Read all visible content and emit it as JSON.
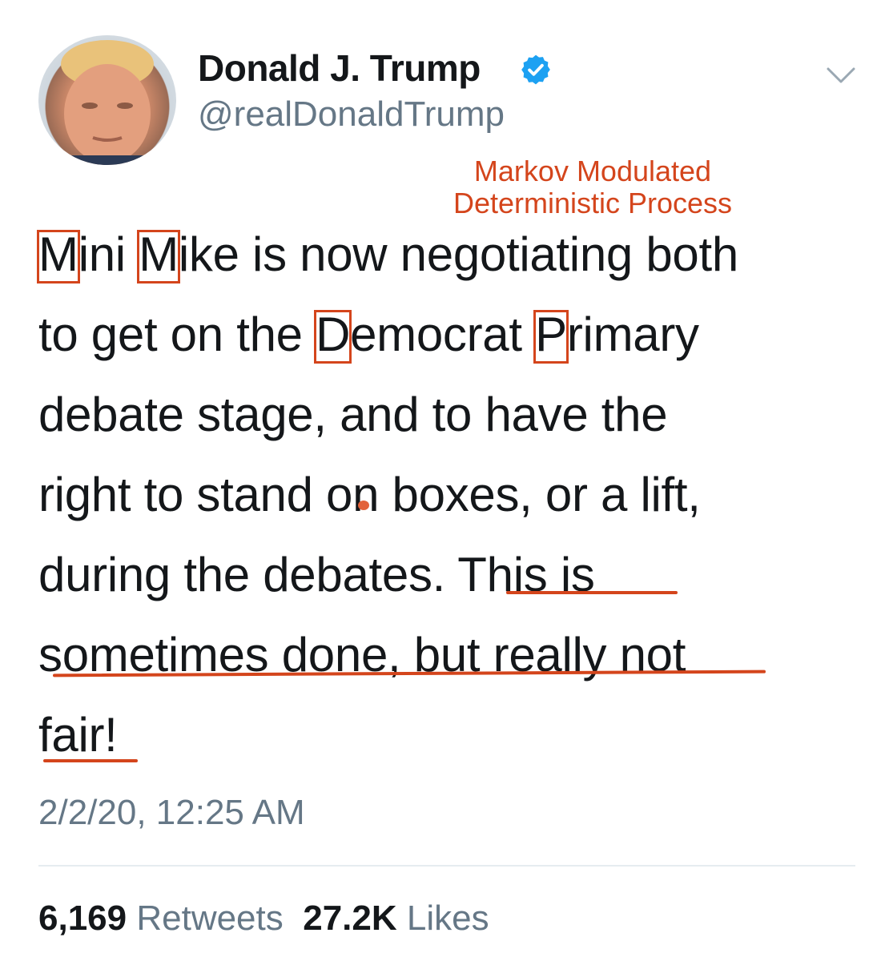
{
  "author": {
    "display_name": "Donald J. Trump",
    "handle": "@realDonaldTrump",
    "verified": true
  },
  "annotation": {
    "line1": "Markov Modulated",
    "line2": "Deterministic Process",
    "color": "#d4451c"
  },
  "tweet": {
    "line1_w1_hl": "M",
    "line1_w1_rest": "ini ",
    "line1_w2_hl": "M",
    "line1_w2_rest": "ike is now negotiating both",
    "line2_start": "to get on the ",
    "line2_hl1": "D",
    "line2_mid": "emocrat ",
    "line2_hl2": "P",
    "line2_end": "rimary",
    "line3": "debate stage, and to have the",
    "line4": "right to stand on boxes, or a lift,",
    "line5": "during the debates. This is",
    "line6": "sometimes done, but really not",
    "line7": "fair!"
  },
  "timestamp": "2/2/20, 12:25 AM",
  "stats": {
    "retweets_count": "6,169",
    "retweets_label": "Retweets",
    "likes_count": "27.2K",
    "likes_label": "Likes"
  },
  "colors": {
    "text": "#14171a",
    "secondary": "#657786",
    "verified": "#1da1f2",
    "annotation": "#d4451c"
  },
  "icons": [
    "verified-badge-icon",
    "chevron-down-icon",
    "avatar"
  ]
}
